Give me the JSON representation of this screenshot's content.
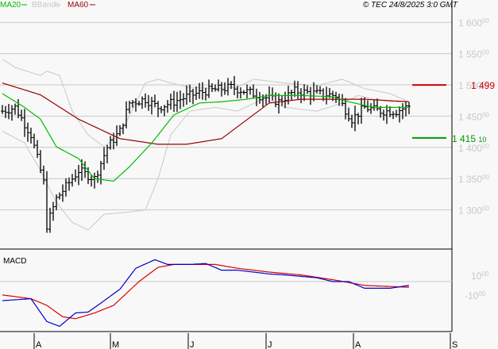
{
  "legend": {
    "ma20": "MA20",
    "bbands": "BBands",
    "ma60": "MA60"
  },
  "copyright": "© TEC 24/8/2025 3:0 GMT",
  "colors": {
    "ma20": "#00bb00",
    "bbands": "#c8c8c8",
    "ma60": "#990000",
    "bars": "#000000",
    "macd": "#0000cc",
    "signal": "#dd0000",
    "resistance": "#cc0000",
    "support": "#009900",
    "grid": "#c8c8c8"
  },
  "chart_data": [
    {
      "type": "line",
      "title": "Price (OHLC bars) with MA20, MA60, Bollinger Bands",
      "y_ticks": [
        {
          "int": "1 600",
          "dec": "00",
          "v": 1600
        },
        {
          "int": "1 550",
          "dec": "00",
          "v": 1550
        },
        {
          "int": "1 500",
          "dec": "00",
          "v": 1500
        },
        {
          "int": "1 450",
          "dec": "00",
          "v": 1450
        },
        {
          "int": "1 400",
          "dec": "00",
          "v": 1400
        },
        {
          "int": "1 350",
          "dec": "00",
          "v": 1350
        },
        {
          "int": "1 300",
          "dec": "00",
          "v": 1300
        }
      ],
      "ylim": [
        1255,
        1625
      ],
      "grid": true,
      "resistance": {
        "value": 1499.9,
        "label": "1 499 9"
      },
      "support": {
        "value": 1415.1,
        "label_int": "1 415",
        "label_dec": "10"
      },
      "close_keypoints": [
        [
          0,
          1458
        ],
        [
          4,
          1464
        ],
        [
          9,
          1420
        ],
        [
          13,
          1344
        ],
        [
          14,
          1275
        ],
        [
          17,
          1318
        ],
        [
          22,
          1350
        ],
        [
          24,
          1363
        ],
        [
          29,
          1350
        ],
        [
          33,
          1400
        ],
        [
          37,
          1426
        ],
        [
          40,
          1471
        ],
        [
          45,
          1477
        ],
        [
          49,
          1464
        ],
        [
          53,
          1471
        ],
        [
          59,
          1483
        ],
        [
          64,
          1490
        ],
        [
          72,
          1496
        ],
        [
          79,
          1486
        ],
        [
          87,
          1473
        ],
        [
          92,
          1490
        ],
        [
          99,
          1486
        ],
        [
          105,
          1483
        ],
        [
          110,
          1445
        ],
        [
          114,
          1464
        ],
        [
          119,
          1458
        ],
        [
          124,
          1458
        ],
        [
          128,
          1466
        ]
      ],
      "ma20": [
        [
          0,
          1486
        ],
        [
          7,
          1464
        ],
        [
          12,
          1445
        ],
        [
          17,
          1401
        ],
        [
          24,
          1382
        ],
        [
          29,
          1350
        ],
        [
          35,
          1346
        ],
        [
          40,
          1369
        ],
        [
          47,
          1407
        ],
        [
          54,
          1452
        ],
        [
          62,
          1471
        ],
        [
          69,
          1473
        ],
        [
          77,
          1477
        ],
        [
          84,
          1483
        ],
        [
          94,
          1483
        ],
        [
          104,
          1481
        ],
        [
          109,
          1473
        ],
        [
          117,
          1464
        ],
        [
          128,
          1464
        ]
      ],
      "ma60": [
        [
          0,
          1503
        ],
        [
          12,
          1484
        ],
        [
          24,
          1445
        ],
        [
          37,
          1414
        ],
        [
          49,
          1405
        ],
        [
          58,
          1405
        ],
        [
          69,
          1414
        ],
        [
          74,
          1433
        ],
        [
          84,
          1471
        ],
        [
          94,
          1477
        ],
        [
          104,
          1477
        ],
        [
          114,
          1477
        ],
        [
          128,
          1473
        ]
      ],
      "bb_upper": [
        [
          0,
          1541
        ],
        [
          4,
          1528
        ],
        [
          12,
          1515
        ],
        [
          14,
          1522
        ],
        [
          18,
          1515
        ],
        [
          22,
          1458
        ],
        [
          27,
          1420
        ],
        [
          32,
          1401
        ],
        [
          37,
          1420
        ],
        [
          42,
          1471
        ],
        [
          45,
          1503
        ],
        [
          49,
          1509
        ],
        [
          53,
          1503
        ],
        [
          59,
          1496
        ],
        [
          67,
          1494
        ],
        [
          74,
          1496
        ],
        [
          79,
          1509
        ],
        [
          89,
          1503
        ],
        [
          99,
          1499
        ],
        [
          107,
          1509
        ],
        [
          114,
          1494
        ],
        [
          122,
          1486
        ],
        [
          128,
          1473
        ]
      ],
      "bb_lower": [
        [
          0,
          1426
        ],
        [
          7,
          1407
        ],
        [
          12,
          1363
        ],
        [
          17,
          1312
        ],
        [
          22,
          1280
        ],
        [
          27,
          1268
        ],
        [
          32,
          1293
        ],
        [
          39,
          1296
        ],
        [
          45,
          1300
        ],
        [
          49,
          1350
        ],
        [
          53,
          1420
        ],
        [
          59,
          1458
        ],
        [
          67,
          1464
        ],
        [
          74,
          1458
        ],
        [
          82,
          1477
        ],
        [
          89,
          1464
        ],
        [
          99,
          1458
        ],
        [
          107,
          1471
        ],
        [
          112,
          1483
        ],
        [
          117,
          1477
        ],
        [
          122,
          1473
        ],
        [
          128,
          1473
        ]
      ]
    },
    {
      "type": "line",
      "title": "MACD",
      "y_ticks": [
        {
          "int": "10",
          "dec": "00",
          "v": 10
        },
        {
          "int": "-10",
          "dec": "00",
          "v": -10
        }
      ],
      "macd": [
        [
          0,
          -20
        ],
        [
          9,
          -18
        ],
        [
          14,
          -42
        ],
        [
          18,
          -47
        ],
        [
          23,
          -33
        ],
        [
          27,
          -32
        ],
        [
          30,
          -25
        ],
        [
          37,
          -8
        ],
        [
          42,
          14
        ],
        [
          48,
          23
        ],
        [
          52,
          18
        ],
        [
          59,
          18
        ],
        [
          64,
          19
        ],
        [
          69,
          12
        ],
        [
          74,
          12
        ],
        [
          84,
          8
        ],
        [
          89,
          7
        ],
        [
          99,
          4
        ],
        [
          104,
          0
        ],
        [
          109,
          0
        ],
        [
          114,
          -7
        ],
        [
          122,
          -7
        ],
        [
          128,
          -4
        ]
      ],
      "signal": [
        [
          0,
          -14
        ],
        [
          9,
          -18
        ],
        [
          14,
          -25
        ],
        [
          19,
          -37
        ],
        [
          23,
          -39
        ],
        [
          29,
          -33
        ],
        [
          35,
          -25
        ],
        [
          43,
          0
        ],
        [
          49,
          15
        ],
        [
          54,
          18
        ],
        [
          67,
          18
        ],
        [
          74,
          14
        ],
        [
          84,
          10
        ],
        [
          94,
          7
        ],
        [
          104,
          2
        ],
        [
          114,
          -4
        ],
        [
          128,
          -6
        ]
      ]
    }
  ],
  "x_axis": [
    {
      "label": "A",
      "i": 10
    },
    {
      "label": "M",
      "i": 34
    },
    {
      "label": "J",
      "i": 58.5
    },
    {
      "label": "J",
      "i": 83
    },
    {
      "label": "A",
      "i": 110.5
    },
    {
      "label": "S",
      "i": 141
    }
  ]
}
